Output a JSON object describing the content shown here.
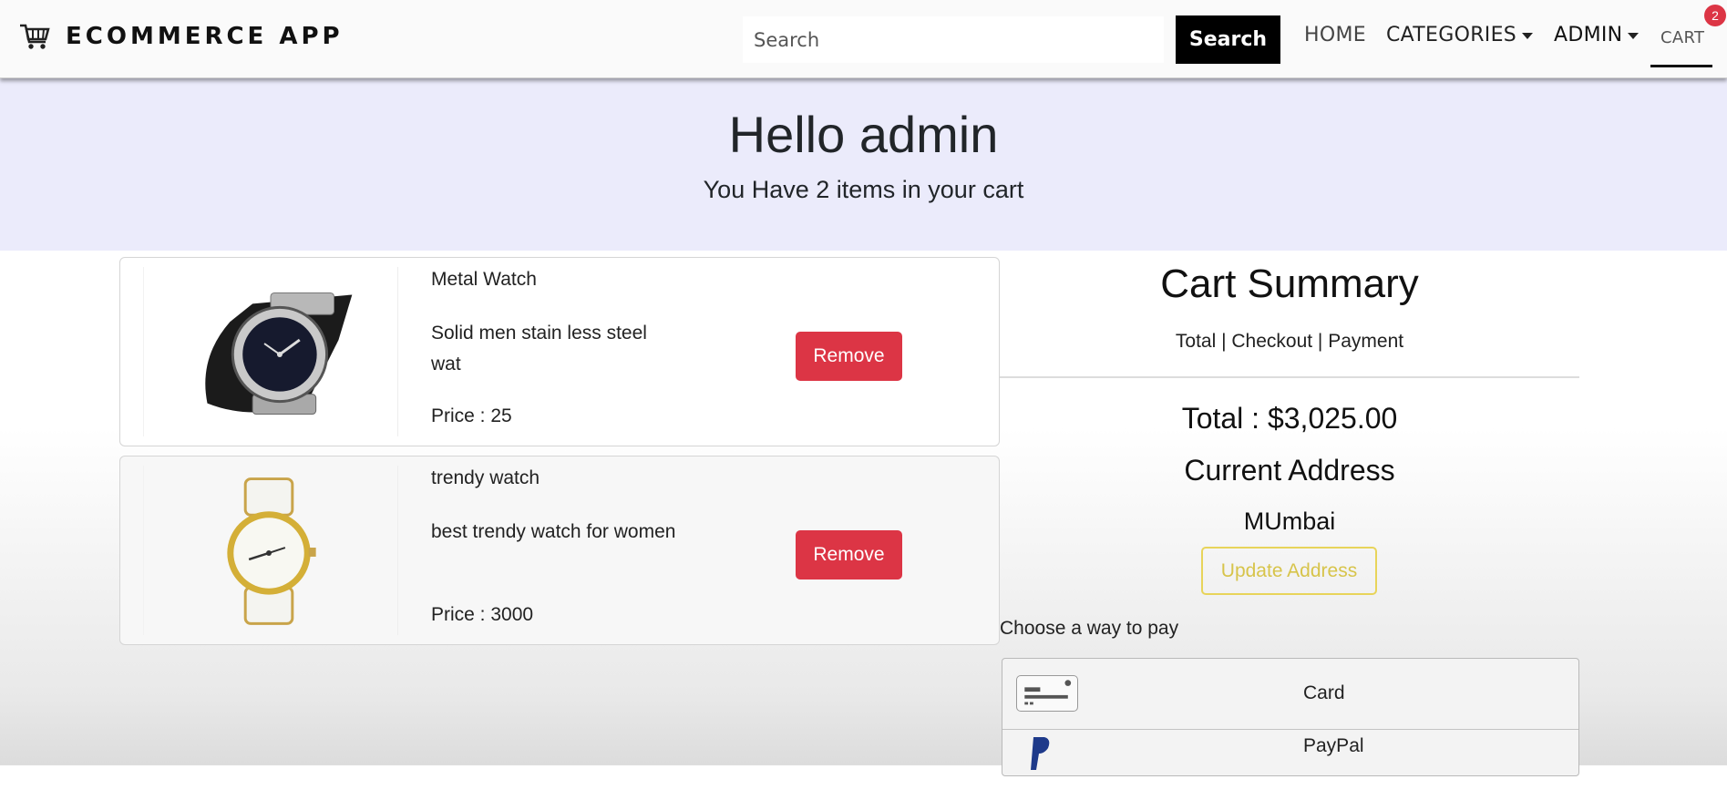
{
  "navbar": {
    "brand": "ECOMMERCE APP",
    "search_placeholder": "Search",
    "search_button": "Search",
    "home": "HOME",
    "categories": "CATEGORIES",
    "admin": "ADMIN",
    "cart": "CART",
    "cart_count": "2"
  },
  "hero": {
    "title": "Hello admin",
    "subtitle": "You Have 2 items in your cart"
  },
  "items": [
    {
      "name": "Metal Watch",
      "description": "Solid men stain less steel wat",
      "price": "Price : 25",
      "remove": "Remove"
    },
    {
      "name": "trendy watch",
      "description": "best trendy watch for women",
      "price": "Price : 3000",
      "remove": "Remove"
    }
  ],
  "summary": {
    "title": "Cart Summary",
    "subtitle": "Total | Checkout | Payment",
    "total": "Total : $3,025.00",
    "address_heading": "Current Address",
    "address": "MUmbai",
    "update_button": "Update Address",
    "pay_label": "Choose a way to pay",
    "options": [
      {
        "label": "Card",
        "icon": "credit-card-icon"
      },
      {
        "label": "PayPal",
        "icon": "paypal-icon"
      }
    ]
  },
  "colors": {
    "remove": "#dc3545",
    "hero_bg": "#ebebfb",
    "update_border": "#e8d45a",
    "badge": "#dc3545"
  }
}
